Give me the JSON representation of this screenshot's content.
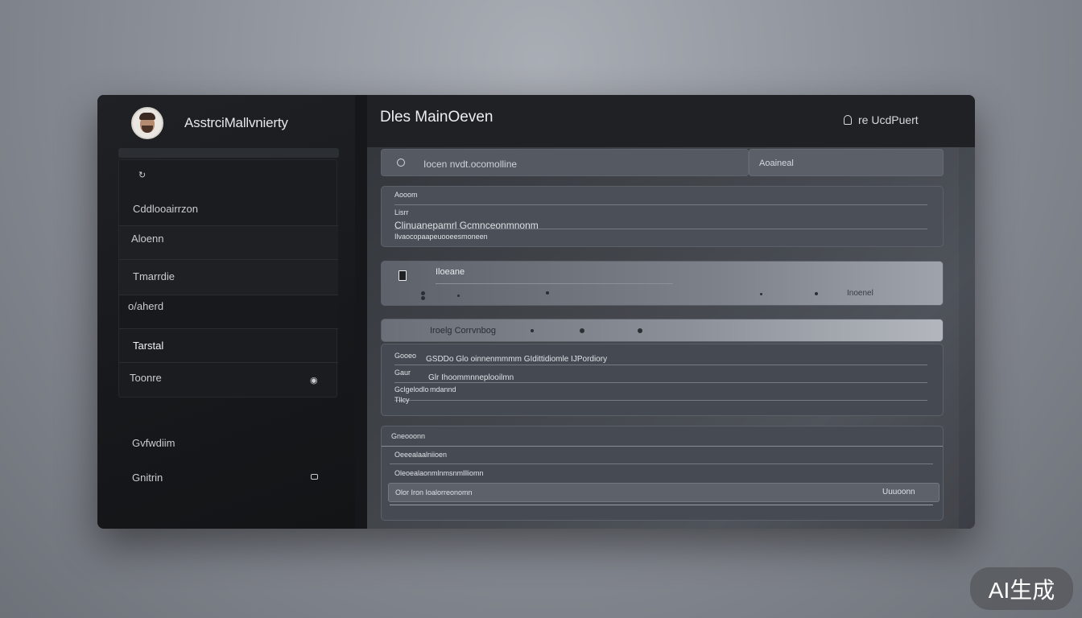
{
  "profile": {
    "name": "AsstrciMallvnierty"
  },
  "sidebar": {
    "items": [
      {
        "label": "Cddlooairrzon"
      },
      {
        "label": "Aloenn"
      },
      {
        "label": "Tmarrdie"
      },
      {
        "label": "o/aherd"
      },
      {
        "label": "Tarstal"
      },
      {
        "label": "Toonre"
      }
    ],
    "bottom_items": [
      {
        "label": "Gvfwdiim"
      },
      {
        "label": "Gnitrin"
      }
    ]
  },
  "header": {
    "title": "Dles MainOeven",
    "action_label": "re UcdPuert"
  },
  "search": {
    "text": "Iocen  nvdt.ocomolline"
  },
  "filter": {
    "text": "Aoaineal"
  },
  "card1": {
    "label": "Aooom",
    "field": "Lisrr",
    "value": "Clinuanepamrl Gcmnceonmnonm",
    "sub": "Ilvaocopaapeuooeesmoneen"
  },
  "card2": {
    "title": "Iloeane",
    "action": "Inoenel"
  },
  "card3": {
    "header": "Iroelg Corrvnbog",
    "rows": [
      {
        "key": "Gooeo",
        "value": "GSDDo Glo oinnenmmmm  GIdittidiomle IJPordiory"
      },
      {
        "key": "Gaur",
        "value": "Glr  Ihoommnneplooilmn"
      },
      {
        "key": "Gclgelodlo",
        "value": "mdannd"
      },
      {
        "key": "Tllcy",
        "value": ""
      }
    ]
  },
  "card4": {
    "label": "Gneooonn",
    "row1": "Oeeealaalniioen",
    "row2": "Oleoealaonmlnmsnmllliomn",
    "input_text": "Olor  Iron  Ioalorreonomn",
    "input_action": "Uuuoonn"
  },
  "watermark": "AI生成"
}
